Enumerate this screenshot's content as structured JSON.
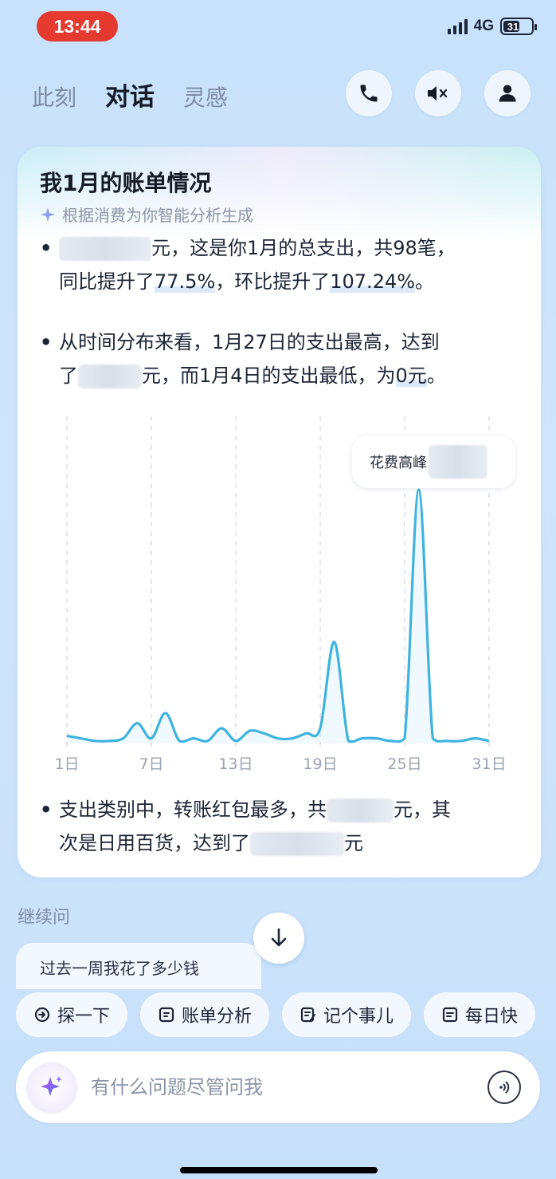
{
  "status_bar": {
    "time": "13:44",
    "network": "4G",
    "battery": "31"
  },
  "header": {
    "tabs": [
      {
        "label": "此刻",
        "active": false
      },
      {
        "label": "对话",
        "active": true
      },
      {
        "label": "灵感",
        "active": false
      }
    ],
    "buttons": [
      "phone-icon",
      "mute-icon",
      "profile-icon"
    ]
  },
  "card": {
    "title": "我1月的账单情况",
    "subtitle": "根据消费为你智能分析生成",
    "bullet1": {
      "prefix": "",
      "text_a": "元，这是你1月的总支出，共98笔，",
      "text_b": "同比提升了",
      "yoy": "77.5%",
      "text_c": "，环比提升了",
      "mom": "107.24%",
      "text_d": "。"
    },
    "bullet2": {
      "line1": "从时间分布来看，1月27日的支出最高，达到",
      "prefix": "了",
      "text_a": "元，而1月4日的支出最低，为",
      "min": "0元",
      "text_b": "。"
    },
    "bullet3": {
      "text_a": "支出类别中，转账红包最多，共",
      "text_b": "元，其",
      "text_c": "次是日用百货，达到了",
      "text_d": "元"
    },
    "peak_label": "花费高峰"
  },
  "chart_data": {
    "type": "area",
    "title": "",
    "x_ticks": [
      "1日",
      "7日",
      "13日",
      "19日",
      "25日",
      "31日"
    ],
    "x": [
      1,
      2,
      3,
      4,
      5,
      6,
      7,
      8,
      9,
      10,
      11,
      12,
      13,
      14,
      15,
      16,
      17,
      18,
      19,
      20,
      21,
      22,
      23,
      24,
      25,
      26,
      27,
      28,
      29,
      30,
      31
    ],
    "values": [
      3,
      2,
      1,
      1,
      2,
      8,
      2,
      12,
      1,
      2,
      1,
      6,
      1,
      5,
      4,
      2,
      2,
      4,
      6,
      40,
      1,
      2,
      2,
      1,
      2,
      100,
      2,
      1,
      1,
      2,
      1
    ],
    "units": "relative (amounts hidden)",
    "annotation": {
      "x": 27,
      "label": "花费高峰"
    },
    "grid": "vertical dashed",
    "color": "#3fb3e0"
  },
  "follow_up": {
    "label": "继续问",
    "question": "过去一周我花了多少钱"
  },
  "chips": [
    {
      "icon": "explore-icon",
      "label": "探一下"
    },
    {
      "icon": "bill-icon",
      "label": "账单分析"
    },
    {
      "icon": "note-icon",
      "label": "记个事儿"
    },
    {
      "icon": "daily-icon",
      "label": "每日快"
    }
  ],
  "input": {
    "placeholder": "有什么问题尽管问我"
  }
}
